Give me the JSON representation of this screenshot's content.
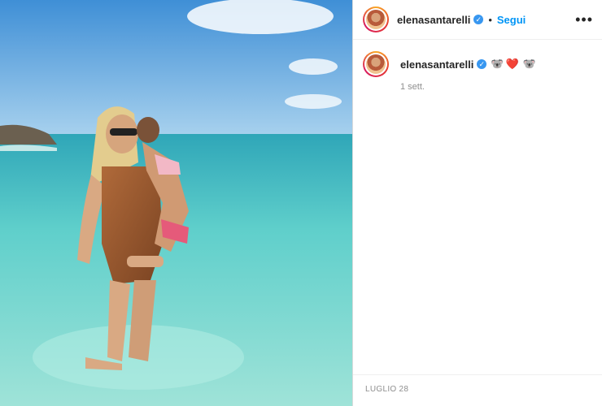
{
  "post": {
    "username": "elenasantarelli",
    "verified_mark": "✓",
    "follow_label": "Segui",
    "more_icon": "•••",
    "separator": "•",
    "caption_emojis": [
      "🐨",
      "❤️",
      "🐨"
    ],
    "time_ago": "1 sett.",
    "date": "LUGLIO 28"
  },
  "icons": [
    "verified-badge-icon",
    "more-options-icon"
  ],
  "colors": {
    "link": "#0095f6",
    "verified": "#3897f0",
    "text": "#262626",
    "muted": "#8e8e8e"
  }
}
